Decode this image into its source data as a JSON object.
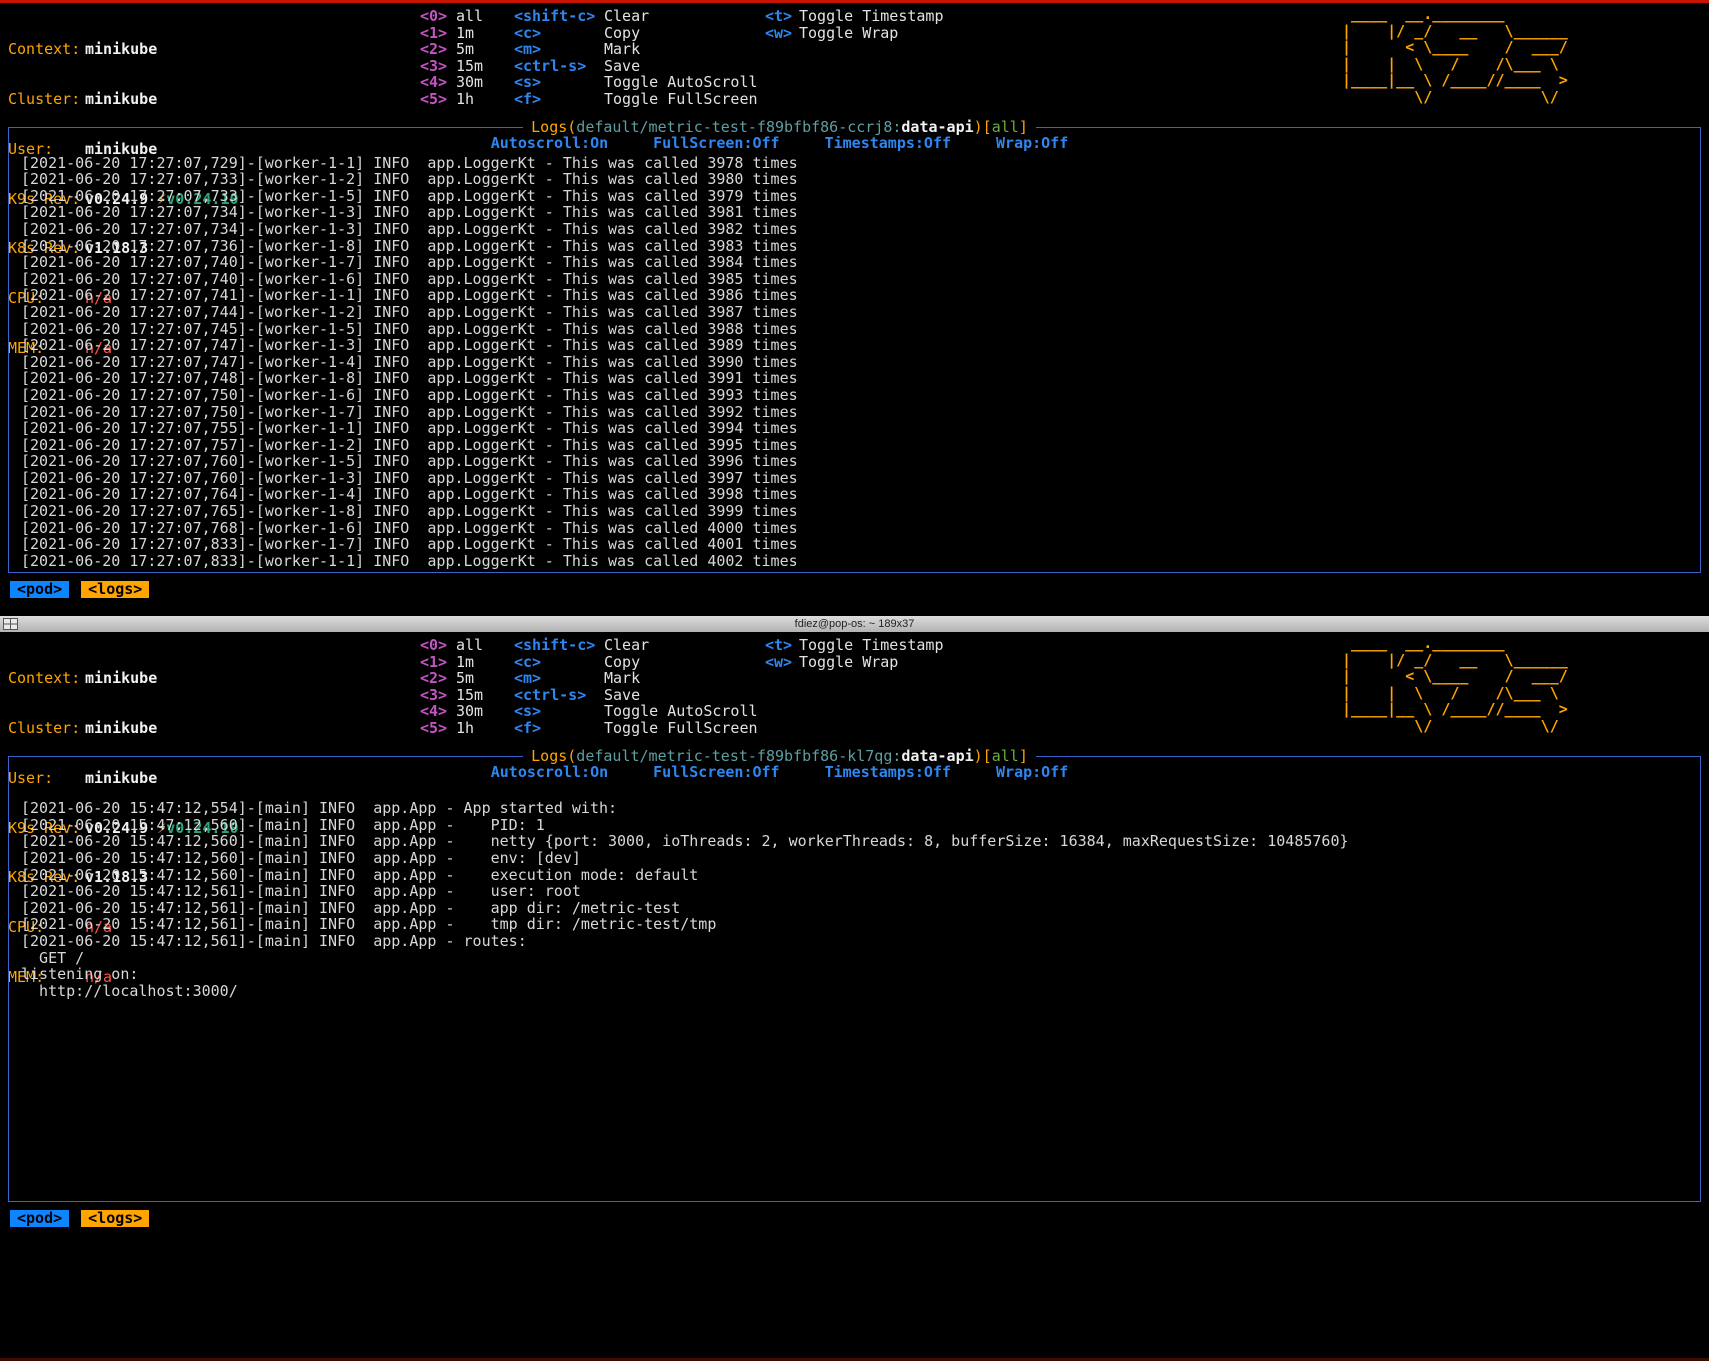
{
  "colors": {
    "background": "#000000",
    "accent_orange": "#ffa500",
    "hotkey_number_magenta": "#c653c6",
    "hotkey_letter_blue": "#2e86f0",
    "border_blue": "#3a62c8",
    "pod_path_teal": "#5f9ea0",
    "scope_green": "#69af3c",
    "metric_na_red": "#ff5347",
    "upgrade_green": "#2aa77a",
    "crumb_pod_bg": "#0e84ff",
    "crumb_logs_bg": "#ffa500",
    "log_text": "#d8d8d8",
    "active_border_red": "#c81400",
    "titlebar_gray": "#c8c8c8"
  },
  "divider": {
    "title": "fdiez@pop-os: ~ 189x37"
  },
  "panes": [
    {
      "header": {
        "info": {
          "context_label": "Context:",
          "context": "minikube",
          "cluster_label": "Cluster:",
          "cluster": "minikube",
          "user_label": "User:",
          "user": "minikube",
          "k9s_label": "K9s Rev:",
          "k9s": "v0.24.9",
          "k9s_bolt": "⚡",
          "k9s_upgrade": "v0.24.10",
          "k8s_label": "K8s Rev:",
          "k8s": "v1.18.3",
          "cpu_label": "CPU:",
          "cpu": "n/a",
          "mem_label": "MEM:",
          "mem": "n/a"
        },
        "menu_ranges": [
          {
            "key": "<0>",
            "label": "all"
          },
          {
            "key": "<1>",
            "label": "1m"
          },
          {
            "key": "<2>",
            "label": "5m"
          },
          {
            "key": "<3>",
            "label": "15m"
          },
          {
            "key": "<4>",
            "label": "30m"
          },
          {
            "key": "<5>",
            "label": "1h"
          }
        ],
        "menu_actions": [
          {
            "key": "<shift-c>",
            "label": "Clear"
          },
          {
            "key": "<c>",
            "label": "Copy"
          },
          {
            "key": "<m>",
            "label": "Mark"
          },
          {
            "key": "<ctrl-s>",
            "label": "Save"
          },
          {
            "key": "<s>",
            "label": "Toggle AutoScroll"
          },
          {
            "key": "<f>",
            "label": "Toggle FullScreen"
          }
        ],
        "menu_toggles": [
          {
            "key": "<t>",
            "label": "Toggle Timestamp"
          },
          {
            "key": "<w>",
            "label": "Toggle Wrap"
          }
        ],
        "logo": " ____  __.________       \n|    |/ _/   __   \\______\n|      < \\____    /  ___/\n|    |  \\   /    /\\___ \\ \n|____|__ \\ /____//____  >\n        \\/            \\/ "
      },
      "logview": {
        "title": {
          "open": "Logs(",
          "path": "default/metric-test-f89bfbf86-ccrj8:",
          "name": "data-api",
          "mid": ")[",
          "scope": "all",
          "close": "]"
        },
        "status": [
          "Autoscroll:On",
          "FullScreen:Off",
          "Timestamps:Off",
          "Wrap:Off"
        ],
        "lines": [
          "[2021-06-20 17:27:07,729]-[worker-1-1] INFO  app.LoggerKt - This was called 3978 times",
          "[2021-06-20 17:27:07,733]-[worker-1-2] INFO  app.LoggerKt - This was called 3980 times",
          "[2021-06-20 17:27:07,733]-[worker-1-5] INFO  app.LoggerKt - This was called 3979 times",
          "[2021-06-20 17:27:07,734]-[worker-1-3] INFO  app.LoggerKt - This was called 3981 times",
          "[2021-06-20 17:27:07,734]-[worker-1-3] INFO  app.LoggerKt - This was called 3982 times",
          "[2021-06-20 17:27:07,736]-[worker-1-8] INFO  app.LoggerKt - This was called 3983 times",
          "[2021-06-20 17:27:07,740]-[worker-1-7] INFO  app.LoggerKt - This was called 3984 times",
          "[2021-06-20 17:27:07,740]-[worker-1-6] INFO  app.LoggerKt - This was called 3985 times",
          "[2021-06-20 17:27:07,741]-[worker-1-1] INFO  app.LoggerKt - This was called 3986 times",
          "[2021-06-20 17:27:07,744]-[worker-1-2] INFO  app.LoggerKt - This was called 3987 times",
          "[2021-06-20 17:27:07,745]-[worker-1-5] INFO  app.LoggerKt - This was called 3988 times",
          "[2021-06-20 17:27:07,747]-[worker-1-3] INFO  app.LoggerKt - This was called 3989 times",
          "[2021-06-20 17:27:07,747]-[worker-1-4] INFO  app.LoggerKt - This was called 3990 times",
          "[2021-06-20 17:27:07,748]-[worker-1-8] INFO  app.LoggerKt - This was called 3991 times",
          "[2021-06-20 17:27:07,750]-[worker-1-6] INFO  app.LoggerKt - This was called 3993 times",
          "[2021-06-20 17:27:07,750]-[worker-1-7] INFO  app.LoggerKt - This was called 3992 times",
          "[2021-06-20 17:27:07,755]-[worker-1-1] INFO  app.LoggerKt - This was called 3994 times",
          "[2021-06-20 17:27:07,757]-[worker-1-2] INFO  app.LoggerKt - This was called 3995 times",
          "[2021-06-20 17:27:07,760]-[worker-1-5] INFO  app.LoggerKt - This was called 3996 times",
          "[2021-06-20 17:27:07,760]-[worker-1-3] INFO  app.LoggerKt - This was called 3997 times",
          "[2021-06-20 17:27:07,764]-[worker-1-4] INFO  app.LoggerKt - This was called 3998 times",
          "[2021-06-20 17:27:07,765]-[worker-1-8] INFO  app.LoggerKt - This was called 3999 times",
          "[2021-06-20 17:27:07,768]-[worker-1-6] INFO  app.LoggerKt - This was called 4000 times",
          "[2021-06-20 17:27:07,833]-[worker-1-7] INFO  app.LoggerKt - This was called 4001 times",
          "[2021-06-20 17:27:07,833]-[worker-1-1] INFO  app.LoggerKt - This was called 4002 times"
        ]
      },
      "crumbs": [
        "<pod>",
        "<logs>"
      ]
    },
    {
      "header": {
        "info": {
          "context_label": "Context:",
          "context": "minikube",
          "cluster_label": "Cluster:",
          "cluster": "minikube",
          "user_label": "User:",
          "user": "minikube",
          "k9s_label": "K9s Rev:",
          "k9s": "v0.24.9",
          "k9s_bolt": "⚡",
          "k9s_upgrade": "v0.24.10",
          "k8s_label": "K8s Rev:",
          "k8s": "v1.18.3",
          "cpu_label": "CPU:",
          "cpu": "n/a",
          "mem_label": "MEM:",
          "mem": "n/a"
        },
        "menu_ranges": [
          {
            "key": "<0>",
            "label": "all"
          },
          {
            "key": "<1>",
            "label": "1m"
          },
          {
            "key": "<2>",
            "label": "5m"
          },
          {
            "key": "<3>",
            "label": "15m"
          },
          {
            "key": "<4>",
            "label": "30m"
          },
          {
            "key": "<5>",
            "label": "1h"
          }
        ],
        "menu_actions": [
          {
            "key": "<shift-c>",
            "label": "Clear"
          },
          {
            "key": "<c>",
            "label": "Copy"
          },
          {
            "key": "<m>",
            "label": "Mark"
          },
          {
            "key": "<ctrl-s>",
            "label": "Save"
          },
          {
            "key": "<s>",
            "label": "Toggle AutoScroll"
          },
          {
            "key": "<f>",
            "label": "Toggle FullScreen"
          }
        ],
        "menu_toggles": [
          {
            "key": "<t>",
            "label": "Toggle Timestamp"
          },
          {
            "key": "<w>",
            "label": "Toggle Wrap"
          }
        ],
        "logo": " ____  __.________       \n|    |/ _/   __   \\______\n|      < \\____    /  ___/\n|    |  \\   /    /\\___ \\ \n|____|__ \\ /____//____  >\n        \\/            \\/ "
      },
      "logview": {
        "title": {
          "open": "Logs(",
          "path": "default/metric-test-f89bfbf86-kl7qg:",
          "name": "data-api",
          "mid": ")[",
          "scope": "all",
          "close": "]"
        },
        "status": [
          "Autoscroll:On",
          "FullScreen:Off",
          "Timestamps:Off",
          "Wrap:Off"
        ],
        "lines": [
          "",
          "[2021-06-20 15:47:12,554]-[main] INFO  app.App - App started with:",
          "[2021-06-20 15:47:12,560]-[main] INFO  app.App -    PID: 1",
          "[2021-06-20 15:47:12,560]-[main] INFO  app.App -    netty {port: 3000, ioThreads: 2, workerThreads: 8, bufferSize: 16384, maxRequestSize: 10485760}",
          "[2021-06-20 15:47:12,560]-[main] INFO  app.App -    env: [dev]",
          "[2021-06-20 15:47:12,560]-[main] INFO  app.App -    execution mode: default",
          "[2021-06-20 15:47:12,561]-[main] INFO  app.App -    user: root",
          "[2021-06-20 15:47:12,561]-[main] INFO  app.App -    app dir: /metric-test",
          "[2021-06-20 15:47:12,561]-[main] INFO  app.App -    tmp dir: /metric-test/tmp",
          "[2021-06-20 15:47:12,561]-[main] INFO  app.App - routes:",
          "  GET /",
          "listening on:",
          "  http://localhost:3000/"
        ]
      },
      "crumbs": [
        "<pod>",
        "<logs>"
      ]
    }
  ]
}
